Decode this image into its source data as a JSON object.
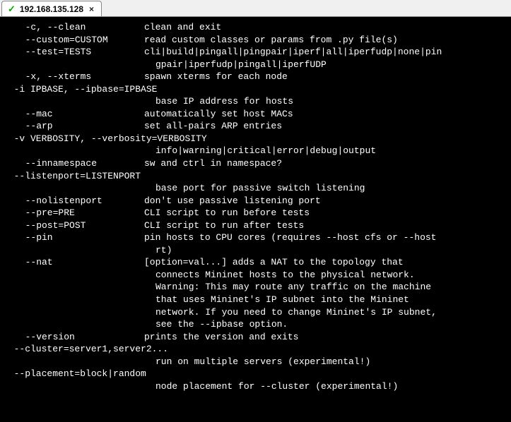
{
  "tab": {
    "title": "192.168.135.128",
    "status_icon": "✓",
    "close_label": "×"
  },
  "terminal": {
    "lines": [
      {
        "opt": "-c, --clean",
        "desc": "clean and exit"
      },
      {
        "opt": "--custom=CUSTOM",
        "desc": "read custom classes or params from .py file(s)"
      },
      {
        "opt": "--test=TESTS",
        "desc": "cli|build|pingall|pingpair|iperf|all|iperfudp|none|pin"
      },
      {
        "opt": "",
        "desc": "gpair|iperfudp|pingall|iperfUDP"
      },
      {
        "opt": "-x, --xterms",
        "desc": "spawn xterms for each node"
      },
      {
        "full": "  -i IPBASE, --ipbase=IPBASE"
      },
      {
        "opt": "",
        "desc": "base IP address for hosts"
      },
      {
        "opt": "--mac",
        "desc": "automatically set host MACs"
      },
      {
        "opt": "--arp",
        "desc": "set all-pairs ARP entries"
      },
      {
        "full": "  -v VERBOSITY, --verbosity=VERBOSITY"
      },
      {
        "opt": "",
        "desc": "info|warning|critical|error|debug|output"
      },
      {
        "opt": "--innamespace",
        "desc": "sw and ctrl in namespace?"
      },
      {
        "full": "  --listenport=LISTENPORT"
      },
      {
        "opt": "",
        "desc": "base port for passive switch listening"
      },
      {
        "opt": "--nolistenport",
        "desc": "don't use passive listening port"
      },
      {
        "opt": "--pre=PRE",
        "desc": "CLI script to run before tests"
      },
      {
        "opt": "--post=POST",
        "desc": "CLI script to run after tests"
      },
      {
        "opt": "--pin",
        "desc": "pin hosts to CPU cores (requires --host cfs or --host"
      },
      {
        "opt": "",
        "desc": "rt)"
      },
      {
        "opt": "--nat",
        "desc": "[option=val...] adds a NAT to the topology that"
      },
      {
        "opt": "",
        "desc": "connects Mininet hosts to the physical network."
      },
      {
        "opt": "",
        "desc": "Warning: This may route any traffic on the machine"
      },
      {
        "opt": "",
        "desc": "that uses Mininet's IP subnet into the Mininet"
      },
      {
        "opt": "",
        "desc": "network. If you need to change Mininet's IP subnet,"
      },
      {
        "opt": "",
        "desc": "see the --ipbase option."
      },
      {
        "opt": "--version",
        "desc": "prints the version and exits"
      },
      {
        "full": "  --cluster=server1,server2..."
      },
      {
        "opt": "",
        "desc": "run on multiple servers (experimental!)"
      },
      {
        "full": "  --placement=block|random"
      },
      {
        "opt": "",
        "desc": "node placement for --cluster (experimental!)"
      }
    ]
  }
}
